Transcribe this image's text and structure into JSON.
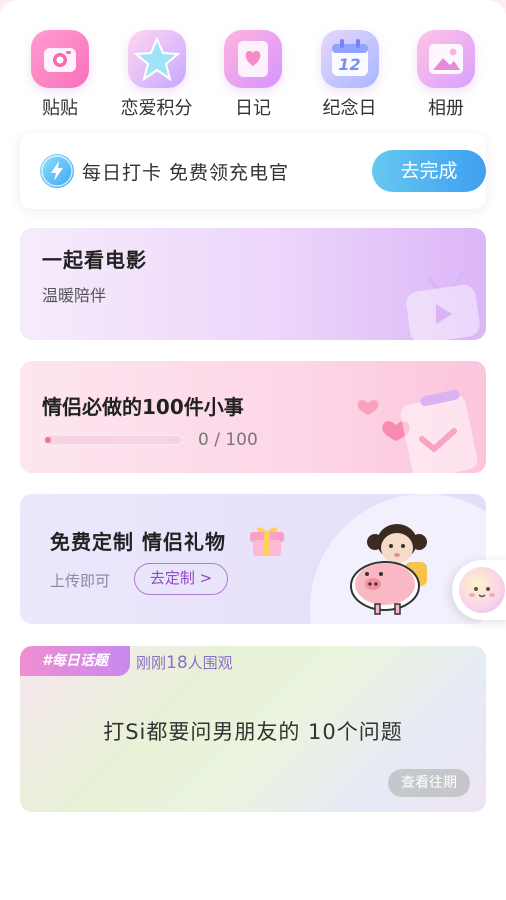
{
  "icons": [
    {
      "label": "贴贴",
      "icon": "camera-icon"
    },
    {
      "label": "恋爱积分",
      "icon": "star-icon"
    },
    {
      "label": "日记",
      "icon": "diary-icon"
    },
    {
      "label": "纪念日",
      "icon": "calendar-icon"
    },
    {
      "label": "相册",
      "icon": "album-icon"
    }
  ],
  "calendar_day": "12",
  "checkin": {
    "text": "每日打卡 免费领充电官",
    "button": "去完成"
  },
  "movie": {
    "title": "一起看电影",
    "subtitle": "温暖陪伴"
  },
  "hundred": {
    "title": "情侣必做的100件小事",
    "progress_text": "0 / 100",
    "progress": 0
  },
  "gift": {
    "title": "免费定制 情侣礼物",
    "subtitle": "上传即可",
    "button": "去定制 >"
  },
  "topic": {
    "tag": "#每日话题",
    "watch_prefix": "刚刚",
    "watch_count": "18",
    "watch_suffix": "人围观",
    "title": "打Si都要问男朋友的 10个问题",
    "button": "查看往期"
  },
  "colors": {
    "accent_blue": "#3e9ff0",
    "accent_purple": "#8f4bc4",
    "progress_red": "#f3738f"
  }
}
